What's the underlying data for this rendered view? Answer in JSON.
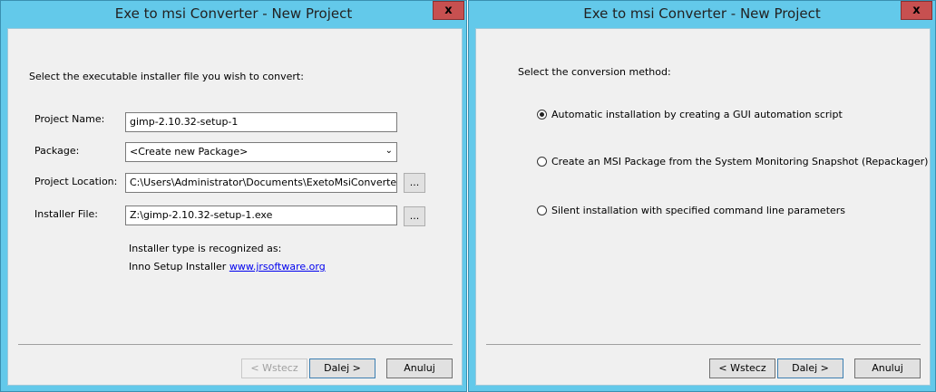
{
  "left": {
    "title": "Exe to msi Converter - New Project",
    "close": "x",
    "instruction": "Select the executable installer file you wish to convert:",
    "project_name_label": "Project Name:",
    "project_name": "gimp-2.10.32-setup-1",
    "package_label": "Package:",
    "package": "<Create new Package>",
    "location_label": "Project Location:",
    "location": "C:\\Users\\Administrator\\Documents\\ExetoMsiConverter",
    "installer_label": "Installer File:",
    "installer": "Z:\\gimp-2.10.32-setup-1.exe",
    "browse": "...",
    "recognized": "Installer type is recognized as:",
    "installer_type": "Inno Setup Installer",
    "link": "www.jrsoftware.org",
    "back": "< Wstecz",
    "next": "Dalej >",
    "cancel": "Anuluj"
  },
  "right": {
    "title": "Exe to msi Converter - New Project",
    "close": "x",
    "instruction": "Select the conversion method:",
    "options": [
      {
        "label": "Automatic installation by creating a GUI automation script",
        "selected": true
      },
      {
        "label": "Create an MSI Package from the System Monitoring Snapshot (Repackager)",
        "selected": false
      },
      {
        "label": "Silent installation with specified command line parameters",
        "selected": false
      }
    ],
    "back": "< Wstecz",
    "next": "Dalej >",
    "cancel": "Anuluj"
  }
}
